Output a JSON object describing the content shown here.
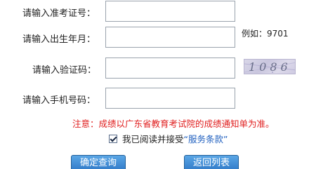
{
  "form": {
    "exam_no_label": "请输入准考证号：",
    "birth_label": "请输入出生年月：",
    "birth_hint": "例如：9701",
    "verify_label": "请输入验证码：",
    "captcha_text": "1086",
    "phone_label": "请输入手机号码："
  },
  "notice": "注意：成绩以广东省教育考试院的成绩通知单为准。",
  "agreement": {
    "prefix": "我已阅读并接受",
    "terms_link": "“服务条款”"
  },
  "buttons": {
    "submit": "确定查询",
    "back": "返回列表"
  }
}
